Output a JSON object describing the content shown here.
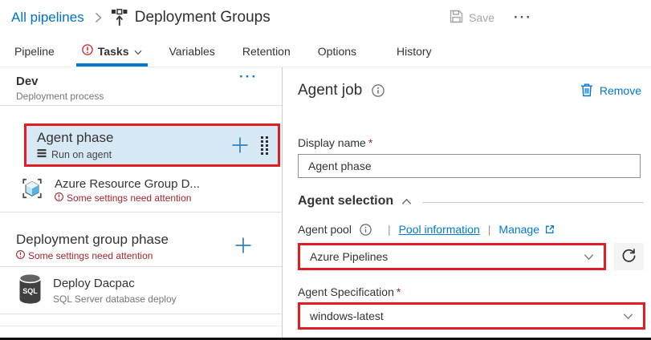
{
  "colors": {
    "accent": "#0078d4",
    "annotation_red": "#e11d23",
    "selection_blue": "#d8e9f6",
    "warning_red": "#a4262c",
    "disabled_gray": "#a6a6a6"
  },
  "header": {
    "breadcrumb": "All pipelines",
    "title": "Deployment Groups",
    "save_label": "Save",
    "more_label": "···"
  },
  "tabs": {
    "items": [
      "Pipeline",
      "Tasks",
      "Variables",
      "Retention",
      "Options",
      "History"
    ]
  },
  "left_panel": {
    "stage": {
      "title": "Dev",
      "subtitle": "Deployment process",
      "more_label": "···"
    },
    "agent_phase": {
      "title": "Agent phase",
      "subtitle": "Run on agent"
    },
    "azure_rg_task": {
      "title": "Azure Resource Group D...",
      "warning": "Some settings need attention"
    },
    "dg_phase": {
      "title": "Deployment group phase",
      "warning": "Some settings need attention"
    },
    "dacpac_task": {
      "title": "Deploy Dacpac",
      "subtitle": "SQL Server database deploy",
      "badge": "SQL"
    }
  },
  "right_panel": {
    "title": "Agent job",
    "remove_label": "Remove",
    "display_name": {
      "label": "Display name",
      "required": "*",
      "value": "Agent phase"
    },
    "agent_selection_title": "Agent selection",
    "agent_pool": {
      "label": "Agent pool",
      "separator": "|",
      "pool_info_link": "Pool information",
      "manage_link": "Manage",
      "value": "Azure Pipelines"
    },
    "agent_spec": {
      "label": "Agent Specification",
      "required": "*",
      "value": "windows-latest"
    }
  }
}
